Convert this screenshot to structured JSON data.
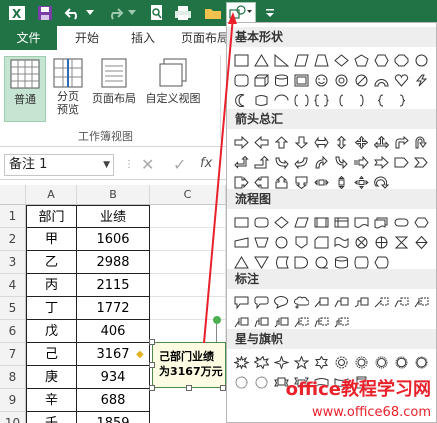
{
  "quick_access": {
    "icons": [
      "excel-icon",
      "save-icon",
      "undo-icon",
      "redo-icon",
      "print-preview-icon",
      "open-folder-icon",
      "shapes-icon",
      "customize-icon"
    ]
  },
  "tabs": [
    "文件",
    "开始",
    "插入",
    "页面布局"
  ],
  "ribbon": {
    "buttons": [
      "普通",
      "分页\n预览",
      "页面布局",
      "自定义视图"
    ],
    "group_label": "工作簿视图"
  },
  "namebox": {
    "value": "备注 1"
  },
  "sheet": {
    "columns": [
      "A",
      "B",
      "C"
    ],
    "rows": [
      "1",
      "2",
      "3",
      "4",
      "5",
      "6",
      "7",
      "8",
      "9",
      "10"
    ],
    "header": [
      "部门",
      "业绩"
    ],
    "data": [
      [
        "甲",
        "1606"
      ],
      [
        "乙",
        "2988"
      ],
      [
        "丙",
        "2115"
      ],
      [
        "丁",
        "1772"
      ],
      [
        "戊",
        "406"
      ],
      [
        "己",
        "3167"
      ],
      [
        "庚",
        "934"
      ],
      [
        "辛",
        "688"
      ],
      [
        "壬",
        "1859"
      ]
    ]
  },
  "callout": {
    "line1": "己部门业绩",
    "line2": "为3167万元"
  },
  "panel": {
    "sections": [
      "基本形状",
      "箭头总汇",
      "流程图",
      "标注",
      "星与旗帜"
    ]
  },
  "watermark": {
    "title": "office教程学习网",
    "url": "www.office68.com"
  },
  "colors": {
    "accent": "#217346",
    "arrow": "#e8212b"
  }
}
